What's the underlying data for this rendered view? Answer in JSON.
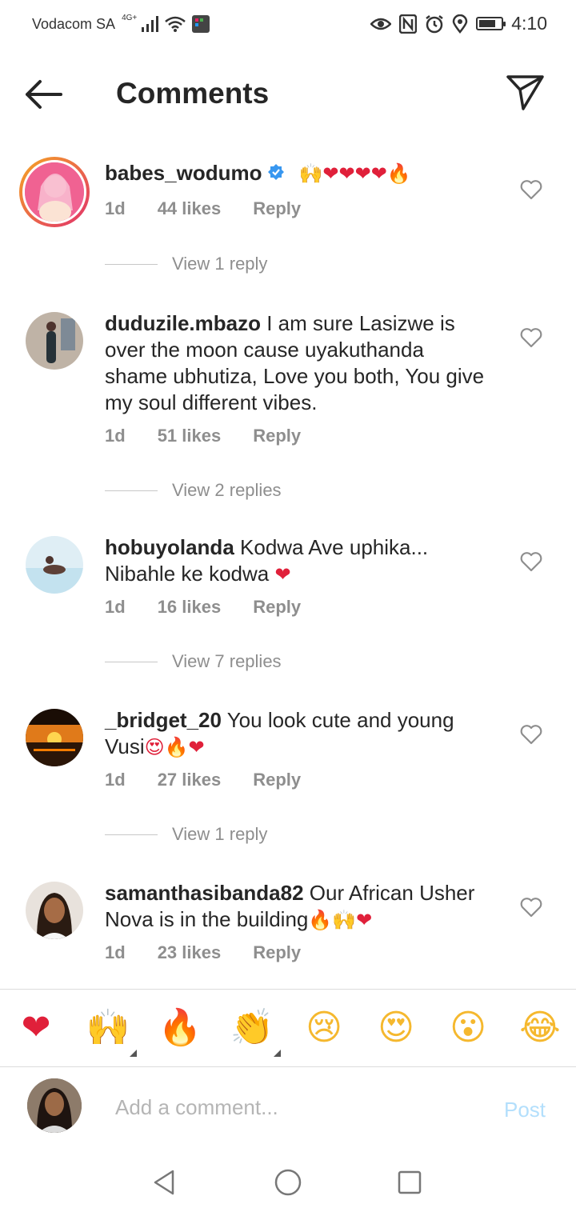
{
  "status_bar": {
    "carrier": "Vodacom SA",
    "network": "4G+",
    "time": "4:10",
    "battery_level": 0.75
  },
  "header": {
    "title": "Comments",
    "back_icon": "arrow-left-icon",
    "send_icon": "paper-plane-icon"
  },
  "comments": [
    {
      "username": "babes_wodumo",
      "verified": true,
      "text": "",
      "emoji": "🙌❤❤❤❤🔥",
      "age": "1d",
      "likes": "44 likes",
      "reply": "Reply",
      "view_replies": "View 1 reply"
    },
    {
      "username": "duduzile.mbazo",
      "text": "I am sure Lasizwe is over the moon cause uyakuthanda shame ubhutiza, Love you both, You give my soul different vibes.",
      "age": "1d",
      "likes": "51 likes",
      "reply": "Reply",
      "view_replies": "View 2 replies"
    },
    {
      "username": "hobuyolanda",
      "text": "Kodwa Ave uphika... Nibahle ke kodwa",
      "emoji": "❤",
      "age": "1d",
      "likes": "16 likes",
      "reply": "Reply",
      "view_replies": "View 7 replies"
    },
    {
      "username": "_bridget_20",
      "text": "You look cute and young Vusi",
      "emoji": "😍🔥❤",
      "age": "1d",
      "likes": "27 likes",
      "reply": "Reply",
      "view_replies": "View 1 reply"
    },
    {
      "username": "samanthasibanda82",
      "text": "Our African Usher Nova is in the building",
      "emoji": "🔥🙌❤",
      "age": "1d",
      "likes": "23 likes",
      "reply": "Reply"
    }
  ],
  "reactions": [
    "❤",
    "🙌",
    "🔥",
    "👏",
    "😢",
    "😍",
    "😮",
    "😂"
  ],
  "composer": {
    "placeholder": "Add a comment...",
    "post_label": "Post"
  },
  "colors": {
    "text": "#262626",
    "secondary": "#8e8e8e",
    "post_disabled": "#b3dffc",
    "verified": "#3897f0",
    "heart": "#e0203a"
  }
}
